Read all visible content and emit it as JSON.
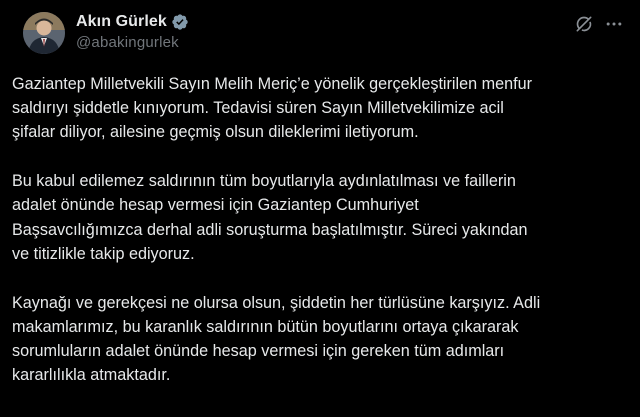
{
  "author": {
    "display_name": "Akın Gürlek",
    "handle": "@abakingurlek",
    "verified": true,
    "avatar_icon": "profile-photo"
  },
  "actions": {
    "grok_icon": "grok-icon",
    "more_icon": "more-icon"
  },
  "colors": {
    "background": "#000000",
    "text": "#e7e9ea",
    "secondary_text": "#71767b",
    "verified_badge": "#829aab"
  },
  "tweet": {
    "paragraphs": [
      "Gaziantep Milletvekili Sayın Melih Meriç’e yönelik gerçekleştirilen menfur\nsaldırıyı şiddetle kınıyorum. Tedavisi süren Sayın Milletvekilimize acil\nşifalar diliyor, ailesine geçmiş olsun dileklerimi iletiyorum.",
      "Bu kabul edilemez saldırının tüm boyutlarıyla aydınlatılması ve faillerin\nadalet önünde hesap vermesi için Gaziantep Cumhuriyet\nBaşsavcılığımızca derhal adli soruşturma başlatılmıştır. Süreci yakından\nve titizlikle takip ediyoruz.",
      "Kaynağı ve gerekçesi ne olursa olsun, şiddetin her türlüsüne karşıyız. Adli\nmakamlarımız, bu karanlık saldırının bütün boyutlarını ortaya çıkararak\nsorumluların adalet önünde hesap vermesi için gereken tüm adımları\nkararlılıkla atmaktadır."
    ]
  }
}
